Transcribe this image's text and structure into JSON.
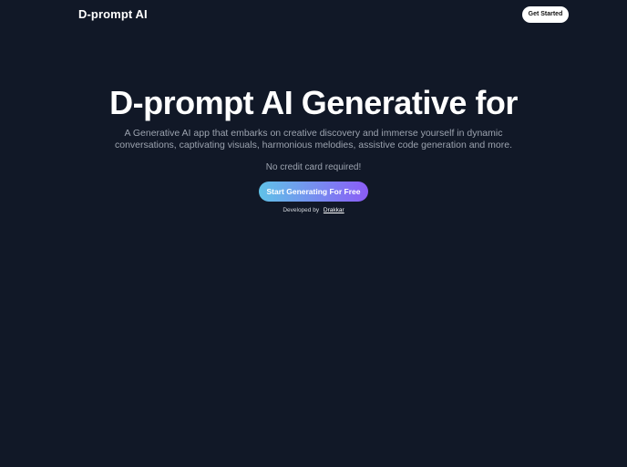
{
  "navbar": {
    "logo": "D-prompt AI",
    "cta_label": "Get Started"
  },
  "hero": {
    "title": "D-prompt AI Generative for",
    "description": "A Generative AI app that embarks on creative discovery and immerse yourself in dynamic conversations, captivating visuals, harmonious melodies, assistive code generation and more.",
    "note": "No credit card required!",
    "cta_label": "Start Generating For Free",
    "developed_by_label": "Developed by",
    "developer_link": "Drakkar"
  },
  "colors": {
    "background": "#111827",
    "cta_gradient_start": "#60c2e8",
    "cta_gradient_end": "#8b5cf6"
  }
}
